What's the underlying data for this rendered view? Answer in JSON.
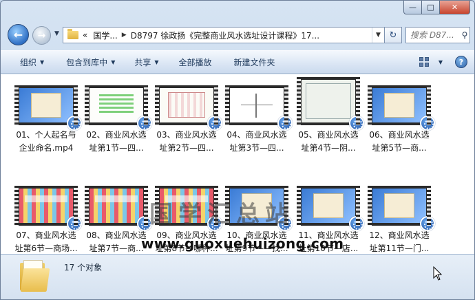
{
  "window": {
    "controls": {
      "minimize": "—",
      "maximize": "□",
      "close": "✕"
    }
  },
  "nav": {
    "back_glyph": "←",
    "forward_glyph": "→",
    "address": {
      "lead": "«",
      "crumbs": [
        "国学...",
        "D8797 徐政扬《完整商业风水选址设计课程》17..."
      ]
    },
    "search_placeholder": "搜索 D87...",
    "search_icon": "magnifier-icon",
    "refresh_icon": "refresh-icon"
  },
  "toolbar": {
    "organize": "组织",
    "include_in_library": "包含到库中",
    "share": "共享",
    "play_all": "全部播放",
    "new_folder": "新建文件夹",
    "help": "?"
  },
  "files": [
    {
      "line1": "01、个人起名与",
      "line2": "企业命名.mp4",
      "scheme": "blue"
    },
    {
      "line1": "02、商业风水选",
      "line2": "址第1节—四...",
      "scheme": "green"
    },
    {
      "line1": "03、商业风水选",
      "line2": "址第2节—四...",
      "scheme": "plan"
    },
    {
      "line1": "04、商业风水选",
      "line2": "址第3节—四...",
      "scheme": "white"
    },
    {
      "line1": "05、商业风水选",
      "line2": "址第4节—阴...",
      "scheme": "pale"
    },
    {
      "line1": "06、商业风水选",
      "line2": "址第5节—商...",
      "scheme": "blue"
    },
    {
      "line1": "07、商业风水选",
      "line2": "址第6节—商场...",
      "scheme": "map"
    },
    {
      "line1": "08、商业风水选",
      "line2": "址第7节—商...",
      "scheme": "map"
    },
    {
      "line1": "09、商业风水选",
      "line2": "址第8节—哪种...",
      "scheme": "map"
    },
    {
      "line1": "10、商业风水选",
      "line2": "址第9节——找...",
      "scheme": "blue"
    },
    {
      "line1": "11、商业风水选",
      "line2": "址第10节—店...",
      "scheme": "blue"
    },
    {
      "line1": "12、商业风水选",
      "line2": "址第11节—门...",
      "scheme": "blue"
    }
  ],
  "watermark": {
    "chinese": "国学汇总站",
    "url": "www.guoxuehuizong.com"
  },
  "status": {
    "count": "17 个对象"
  }
}
